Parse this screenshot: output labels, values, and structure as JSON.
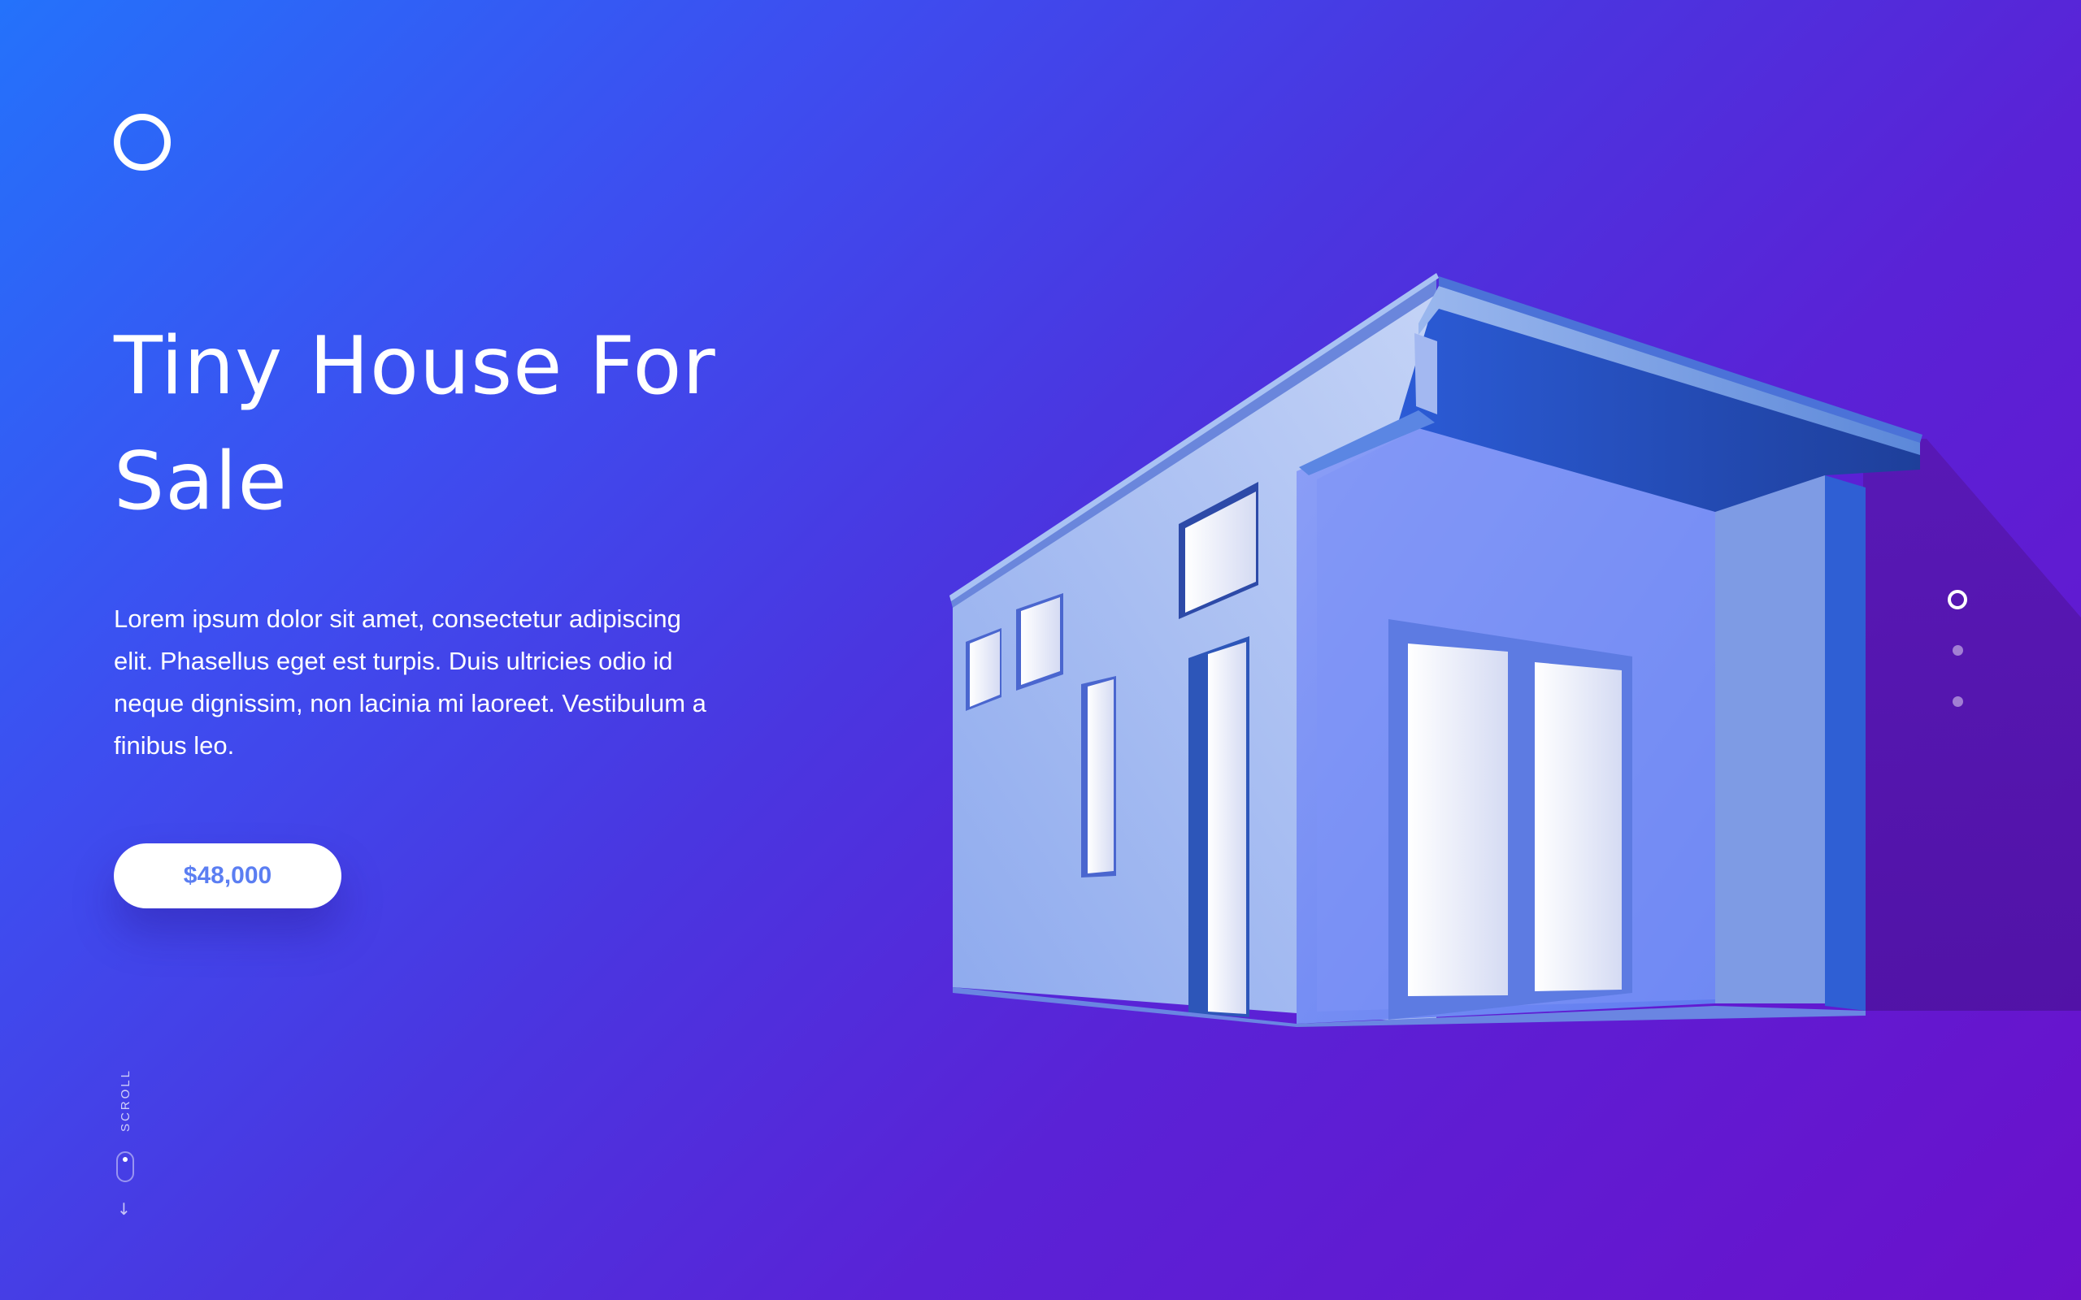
{
  "hero": {
    "title": "Tiny House For Sale",
    "description": "Lorem ipsum dolor sit amet, consectetur adipiscing elit. Phasellus eget est turpis. Duis ultricies odio id neque dignissim, non lacinia mi laoreet. Vestibulum a finibus leo.",
    "price_label": "$48,000"
  },
  "scroll": {
    "label": "SCROLL",
    "arrow": "↓"
  },
  "slider": {
    "total": 3,
    "active_index": 0
  },
  "icons": {
    "logo": "circle-logo-icon",
    "mouse": "mouse-scroll-icon",
    "arrow": "arrow-down-icon"
  },
  "colors": {
    "background_start": "#2472fb",
    "background_end": "#6a11cb",
    "accent": "#5b7ef2",
    "white": "#ffffff"
  }
}
